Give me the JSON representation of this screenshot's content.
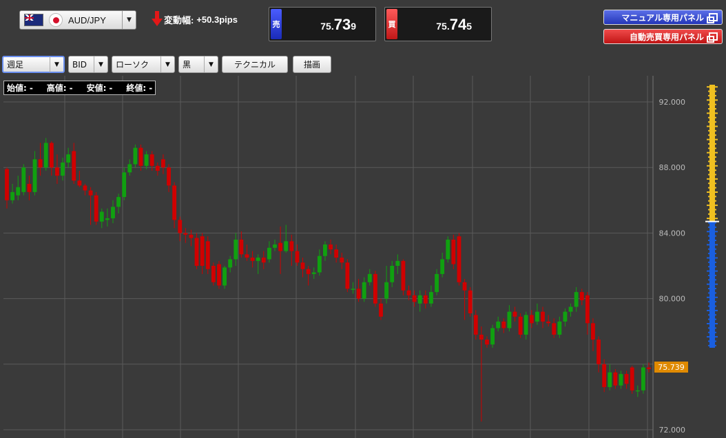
{
  "header": {
    "pair": "AUD/JPY",
    "pair_flags": [
      "australia-flag",
      "japan-flag"
    ],
    "change_label": "変動幅:",
    "change_value": "+50.3pips",
    "change_direction": "down"
  },
  "quotes": {
    "sell": {
      "tag": "売",
      "p1": "75.",
      "p2": "73",
      "p3": "9",
      "color": "#2a3ce0"
    },
    "buy": {
      "tag": "買",
      "p1": "75.",
      "p2": "74",
      "p3": "5",
      "color": "#e02020"
    }
  },
  "panels": {
    "manual": "マニュアル専用パネル",
    "auto": "自動売買専用パネル"
  },
  "toolbar": {
    "period": "週足",
    "price_type": "BID",
    "chart_style": "ローソク",
    "theme": "黒",
    "technical": "テクニカル",
    "draw": "描画"
  },
  "ohlc": {
    "open_label": "始値:",
    "open": "-",
    "high_label": "高値:",
    "high": "-",
    "low_label": "安値:",
    "low": "-",
    "close_label": "終値:",
    "close": "-"
  },
  "chart_data": {
    "type": "candlestick",
    "y_ticks": [
      "92.000",
      "88.000",
      "84.000",
      "80.000",
      "76.000",
      "72.000"
    ],
    "ylim": [
      72,
      92.5
    ],
    "current_price": "75.739",
    "colors": {
      "up": "#10a010",
      "down": "#d00000",
      "price_tag": "#e08a00"
    },
    "candles": [
      [
        87.9,
        86.0,
        88.0,
        85.5
      ],
      [
        86.0,
        86.5,
        87.0,
        85.8
      ],
      [
        86.3,
        86.8,
        87.5,
        86.0
      ],
      [
        86.5,
        88.0,
        88.2,
        86.3
      ],
      [
        87.0,
        86.5,
        87.5,
        86.0
      ],
      [
        86.5,
        88.5,
        89.0,
        86.3
      ],
      [
        88.5,
        88.0,
        89.5,
        87.5
      ],
      [
        88.0,
        89.5,
        89.8,
        87.8
      ],
      [
        89.5,
        88.0,
        89.6,
        87.5
      ],
      [
        88.0,
        87.5,
        88.8,
        87.0
      ],
      [
        87.5,
        88.3,
        88.6,
        87.2
      ],
      [
        88.3,
        88.8,
        89.2,
        88.0
      ],
      [
        89.0,
        87.2,
        89.5,
        87.0
      ],
      [
        87.2,
        86.9,
        87.8,
        86.8
      ],
      [
        86.9,
        86.6,
        87.0,
        86.3
      ],
      [
        86.6,
        86.3,
        86.8,
        84.5
      ],
      [
        86.3,
        84.7,
        86.5,
        84.5
      ],
      [
        84.7,
        85.3,
        85.5,
        84.3
      ],
      [
        84.8,
        84.9,
        85.5,
        84.4
      ],
      [
        84.9,
        85.6,
        86.0,
        84.6
      ],
      [
        85.6,
        86.2,
        86.4,
        85.2
      ],
      [
        86.2,
        87.7,
        88.0,
        86.0
      ],
      [
        87.7,
        88.2,
        88.5,
        87.5
      ],
      [
        88.2,
        89.2,
        89.4,
        88.0
      ],
      [
        89.2,
        88.1,
        89.4,
        87.8
      ],
      [
        88.1,
        88.8,
        89.0,
        87.9
      ],
      [
        88.8,
        88.1,
        89.0,
        87.8
      ],
      [
        88.1,
        87.8,
        88.3,
        87.5
      ],
      [
        88.5,
        88.0,
        88.8,
        87.6
      ],
      [
        88.0,
        86.9,
        88.2,
        86.5
      ],
      [
        86.9,
        84.8,
        87.1,
        84.3
      ],
      [
        84.8,
        84.0,
        85.0,
        83.5
      ],
      [
        84.0,
        83.9,
        84.3,
        83.4
      ],
      [
        83.9,
        83.7,
        84.2,
        83.2
      ],
      [
        83.7,
        82.0,
        84.0,
        81.8
      ],
      [
        83.8,
        82.0,
        84.0,
        81.5
      ],
      [
        83.5,
        81.8,
        83.8,
        81.5
      ],
      [
        82.0,
        81.0,
        82.2,
        80.8
      ],
      [
        82.1,
        80.8,
        82.3,
        80.6
      ],
      [
        80.8,
        81.9,
        82.0,
        80.6
      ],
      [
        81.9,
        82.4,
        82.6,
        81.6
      ],
      [
        82.4,
        83.6,
        84.0,
        82.0
      ],
      [
        83.6,
        82.7,
        84.1,
        82.5
      ],
      [
        82.7,
        82.5,
        83.3,
        82.3
      ],
      [
        82.5,
        82.3,
        82.9,
        81.9
      ],
      [
        82.3,
        82.5,
        82.7,
        81.5
      ],
      [
        82.5,
        82.2,
        82.9,
        81.8
      ],
      [
        82.4,
        83.1,
        83.5,
        82.2
      ],
      [
        83.1,
        83.3,
        83.6,
        82.9
      ],
      [
        83.4,
        82.9,
        84.4,
        81.5
      ],
      [
        82.9,
        83.5,
        84.5,
        82.8
      ],
      [
        83.5,
        82.9,
        83.9,
        82.0
      ],
      [
        82.9,
        82.2,
        83.3,
        82.0
      ],
      [
        82.2,
        81.8,
        82.5,
        81.3
      ],
      [
        81.8,
        81.5,
        82.0,
        80.8
      ],
      [
        81.5,
        81.6,
        81.9,
        81.2
      ],
      [
        81.6,
        82.6,
        83.0,
        81.4
      ],
      [
        82.6,
        83.3,
        83.5,
        82.3
      ],
      [
        83.3,
        83.0,
        83.6,
        82.7
      ],
      [
        83.0,
        82.5,
        83.3,
        82.2
      ],
      [
        82.5,
        82.2,
        82.8,
        81.8
      ],
      [
        82.2,
        80.6,
        82.4,
        80.4
      ],
      [
        80.6,
        80.6,
        81.0,
        80.3
      ],
      [
        80.6,
        80.0,
        81.2,
        79.8
      ],
      [
        80.0,
        81.0,
        81.3,
        79.8
      ],
      [
        81.0,
        81.5,
        81.8,
        80.8
      ],
      [
        81.5,
        79.7,
        81.7,
        79.5
      ],
      [
        79.7,
        78.9,
        80.0,
        78.7
      ],
      [
        80.0,
        81.0,
        82.0,
        79.7
      ],
      [
        81.0,
        82.0,
        82.3,
        80.7
      ],
      [
        82.0,
        82.3,
        82.7,
        81.5
      ],
      [
        82.3,
        80.5,
        82.4,
        80.2
      ],
      [
        80.5,
        80.2,
        80.8,
        79.9
      ],
      [
        80.2,
        79.8,
        80.5,
        79.5
      ],
      [
        79.7,
        80.2,
        80.5,
        79.2
      ],
      [
        80.2,
        79.7,
        80.5,
        79.4
      ],
      [
        79.7,
        80.4,
        80.8,
        79.5
      ],
      [
        80.4,
        81.5,
        81.8,
        80.2
      ],
      [
        81.5,
        82.4,
        82.8,
        81.3
      ],
      [
        82.4,
        83.6,
        83.8,
        82.2
      ],
      [
        83.6,
        82.1,
        83.9,
        81.8
      ],
      [
        83.8,
        81.0,
        84.0,
        80.8
      ],
      [
        81.0,
        80.5,
        81.2,
        78.7
      ],
      [
        80.5,
        79.1,
        80.7,
        78.9
      ],
      [
        79.0,
        77.8,
        79.3,
        77.5
      ],
      [
        77.8,
        77.5,
        78.3,
        72.5
      ],
      [
        77.5,
        77.2,
        77.7,
        77.0
      ],
      [
        77.2,
        78.2,
        78.4,
        77.0
      ],
      [
        78.2,
        78.6,
        78.9,
        78.0
      ],
      [
        78.6,
        78.2,
        78.8,
        77.9
      ],
      [
        78.2,
        79.2,
        79.6,
        78.0
      ],
      [
        79.2,
        78.9,
        79.5,
        78.6
      ],
      [
        78.9,
        77.8,
        79.1,
        77.6
      ],
      [
        77.8,
        79.0,
        79.2,
        77.5
      ],
      [
        79.0,
        78.5,
        79.3,
        78.2
      ],
      [
        78.6,
        79.2,
        79.7,
        78.4
      ],
      [
        79.2,
        78.6,
        79.5,
        78.2
      ],
      [
        78.6,
        78.5,
        79.0,
        78.3
      ],
      [
        78.5,
        77.8,
        78.8,
        77.6
      ],
      [
        77.8,
        78.6,
        78.9,
        77.6
      ],
      [
        78.6,
        79.2,
        79.4,
        78.3
      ],
      [
        79.2,
        79.5,
        79.7,
        78.9
      ],
      [
        79.5,
        80.4,
        80.7,
        79.2
      ],
      [
        80.4,
        79.9,
        80.6,
        79.6
      ],
      [
        80.2,
        78.5,
        80.4,
        77.8
      ],
      [
        78.5,
        77.5,
        78.8,
        76.8
      ],
      [
        77.5,
        76.0,
        77.7,
        75.5
      ],
      [
        76.0,
        74.6,
        76.3,
        74.3
      ],
      [
        74.6,
        75.5,
        76.0,
        74.4
      ],
      [
        75.5,
        74.7,
        75.7,
        74.5
      ],
      [
        74.7,
        75.4,
        75.6,
        74.5
      ],
      [
        75.4,
        74.8,
        75.6,
        74.5
      ],
      [
        75.8,
        74.4,
        75.9,
        74.2
      ],
      [
        74.4,
        74.4,
        74.7,
        74.0
      ],
      [
        74.4,
        75.8,
        76.0,
        74.2
      ],
      [
        75.8,
        75.7,
        76.1,
        75.5
      ]
    ],
    "volume_gauge": {
      "ask_fraction": 0.52,
      "bid_fraction": 0.48,
      "ask_color": "#f0c020",
      "bid_color": "#1a5fe0"
    }
  }
}
